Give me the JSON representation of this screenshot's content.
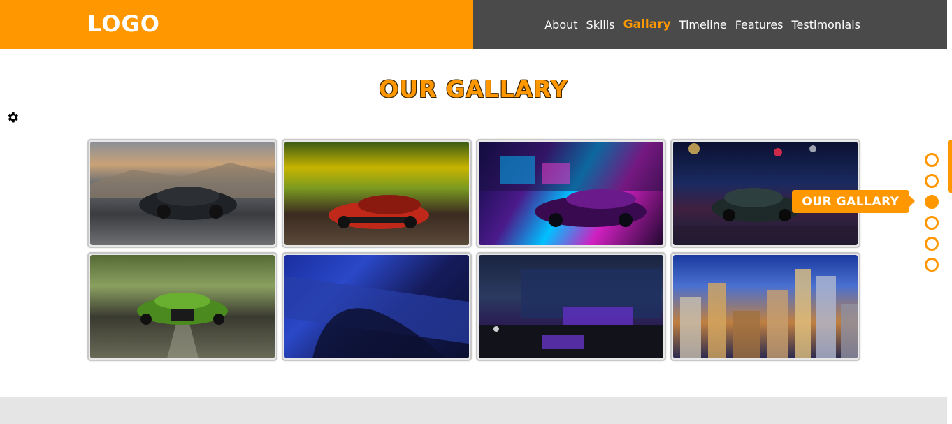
{
  "header": {
    "logo": "LOGO",
    "nav": [
      {
        "label": "About"
      },
      {
        "label": "Skills"
      },
      {
        "label": "Gallary"
      },
      {
        "label": "Timeline"
      },
      {
        "label": "Features"
      },
      {
        "label": "Testimonials"
      }
    ],
    "active_nav": "Gallary"
  },
  "section": {
    "title": "OUR GALLARY"
  },
  "gallery": {
    "images": [
      {
        "icon": "car-photo-icon"
      },
      {
        "icon": "car-photo-icon"
      },
      {
        "icon": "car-photo-icon"
      },
      {
        "icon": "car-photo-icon"
      },
      {
        "icon": "car-photo-icon"
      },
      {
        "icon": "keyboard-photo-icon"
      },
      {
        "icon": "room-photo-icon"
      },
      {
        "icon": "city-photo-icon"
      }
    ]
  },
  "bullets": {
    "count": 6,
    "active_index": 2,
    "tooltip": "OUR GALLARY"
  },
  "settings": {
    "icon": "gear-icon"
  },
  "colors": {
    "accent": "#ff9800",
    "header_dark": "#4a4a4a",
    "footer_band": "#e5e5e5"
  }
}
